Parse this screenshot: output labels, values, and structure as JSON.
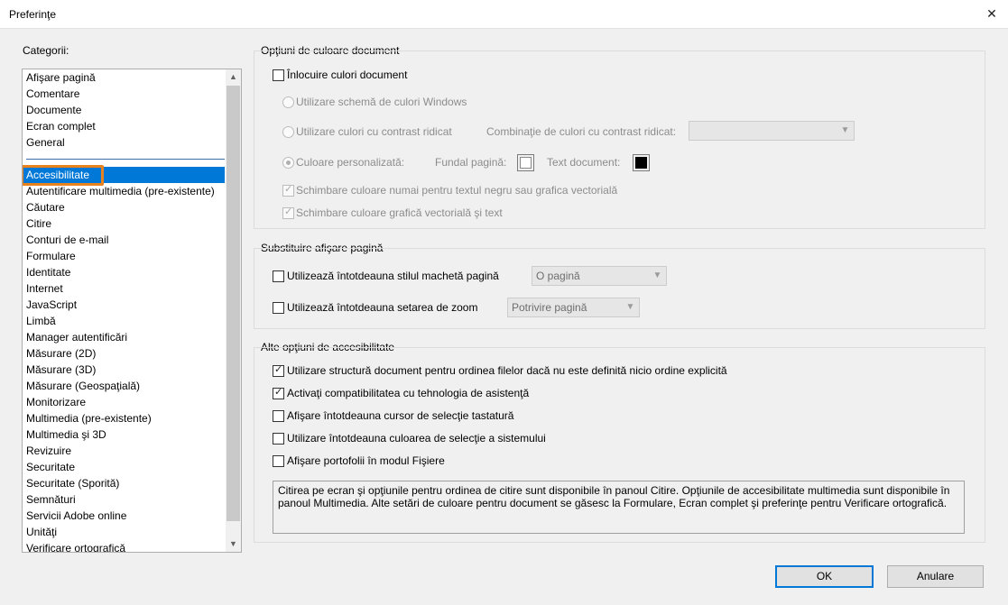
{
  "window": {
    "title": "Preferinţe",
    "close_glyph": "✕"
  },
  "categories": {
    "label": "Categorii:",
    "top_items": [
      "Afişare pagină",
      "Comentare",
      "Documente",
      "Ecran complet",
      "General"
    ],
    "selected": "Accesibilitate",
    "items": [
      "Autentificare multimedia (pre-existente)",
      "Căutare",
      "Citire",
      "Conturi de e-mail",
      "Formulare",
      "Identitate",
      "Internet",
      "JavaScript",
      "Limbă",
      "Manager autentificări",
      "Măsurare (2D)",
      "Măsurare (3D)",
      "Măsurare (Geospaţială)",
      "Monitorizare",
      "Multimedia (pre-existente)",
      "Multimedia şi 3D",
      "Revizuire",
      "Securitate",
      "Securitate (Sporită)",
      "Semnături",
      "Servicii Adobe online",
      "Unităţi",
      "Verificare ortografică"
    ]
  },
  "doc_colors": {
    "title": "Opţiuni de culoare document",
    "replace_label": "Înlocuire culori document",
    "windows_scheme": "Utilizare schemă de culori Windows",
    "high_contrast": "Utilizare culori cu contrast ridicat",
    "high_contrast_combo_label": "Combinaţie de culori cu contrast ridicat:",
    "high_contrast_combo_value": "",
    "custom_color": "Culoare personalizată:",
    "page_bg_label": "Fundal pagină:",
    "text_doc_label": "Text document:",
    "page_bg_color": "#ffffff",
    "text_color": "#000000",
    "only_black_text": "Schimbare culoare numai pentru textul negru sau grafica vectorială",
    "vector_and_text": "Schimbare culoare grafică vectorială şi text"
  },
  "page_display": {
    "title": "Substituire afişare pagină",
    "layout_label": "Utilizează întotdeauna stilul machetă pagină",
    "layout_value": "O pagină",
    "zoom_label": "Utilizează întotdeauna setarea de zoom",
    "zoom_value": "Potrivire pagină"
  },
  "other_options": {
    "title": "Alte opţiuni de accesibilitate",
    "items": [
      {
        "label": "Utilizare structură document pentru ordinea filelor dacă nu este definită nicio ordine explicită",
        "checked": true
      },
      {
        "label": "Activaţi compatibilitatea cu tehnologia de asistenţă",
        "checked": true
      },
      {
        "label": "Afişare întotdeauna cursor de selecţie tastatură",
        "checked": false
      },
      {
        "label": "Utilizare întotdeauna culoarea de selecţie a sistemului",
        "checked": false
      },
      {
        "label": "Afişare portofolii în modul Fişiere",
        "checked": false
      }
    ],
    "info_text": "Citirea pe ecran şi opţiunile pentru ordinea de citire sunt disponibile în panoul Citire. Opţiunile de accesibilitate multimedia sunt disponibile în panoul Multimedia. Alte setări de culoare pentru document se găsesc la Formulare, Ecran complet şi preferinţe pentru Verificare ortografică."
  },
  "buttons": {
    "ok": "OK",
    "cancel": "Anulare"
  },
  "colors": {
    "selection": "#0078d7",
    "highlight_box": "#e8821f",
    "default_button_border": "#0078d7"
  },
  "icons": {
    "dropdown": "chevron-down-icon",
    "scroll_up": "scroll-up-arrow-icon",
    "scroll_down": "scroll-down-arrow-icon"
  }
}
